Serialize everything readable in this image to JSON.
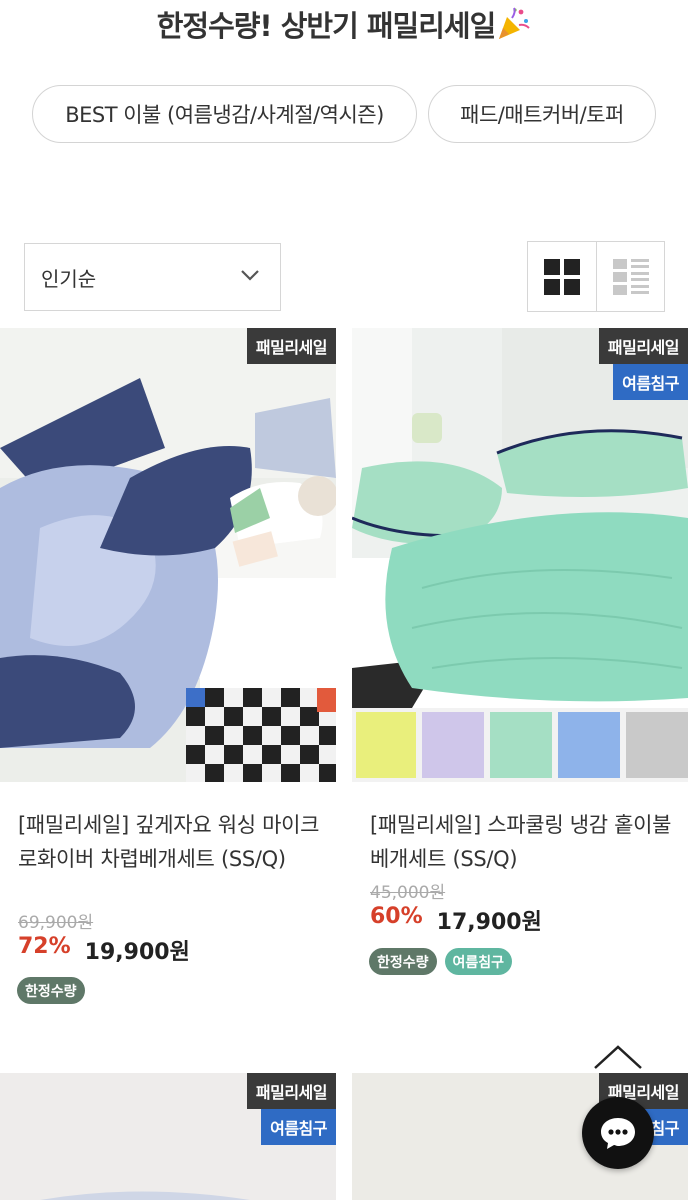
{
  "header": {
    "title": "한정수량! 상반기 패밀리세일"
  },
  "chips": [
    {
      "label": "BEST 이불 (여름냉감/사계절/역시즌)"
    },
    {
      "label": "패드/매트커버/토퍼"
    }
  ],
  "sort": {
    "selected": "인기순"
  },
  "products": [
    {
      "badges": [
        "패밀리세일"
      ],
      "name": "[패밀리세일] 깊게자요 워싱 마이크로화이버 차렵베개세트 (SS/Q)",
      "original_price": "69,900원",
      "discount": "72%",
      "price": "19,900원",
      "tags": [
        "한정수량"
      ]
    },
    {
      "badges": [
        "패밀리세일",
        "여름침구"
      ],
      "name": "[패밀리세일] 스파쿨링 냉감 홑이불 베개세트 (SS/Q)",
      "original_price": "45,000원",
      "discount": "60%",
      "price": "17,900원",
      "tags": [
        "한정수량",
        "여름침구"
      ]
    },
    {
      "badges": [
        "패밀리세일",
        "여름침구"
      ]
    },
    {
      "badges": [
        "패밀리세일",
        "여름침구"
      ]
    }
  ],
  "colors": {
    "accent_red": "#d6402a",
    "badge_dark": "#3a3a3a",
    "badge_blue": "#2f6bc4",
    "tag_green": "#5f7868",
    "tag_mint": "#5fb6a0"
  }
}
